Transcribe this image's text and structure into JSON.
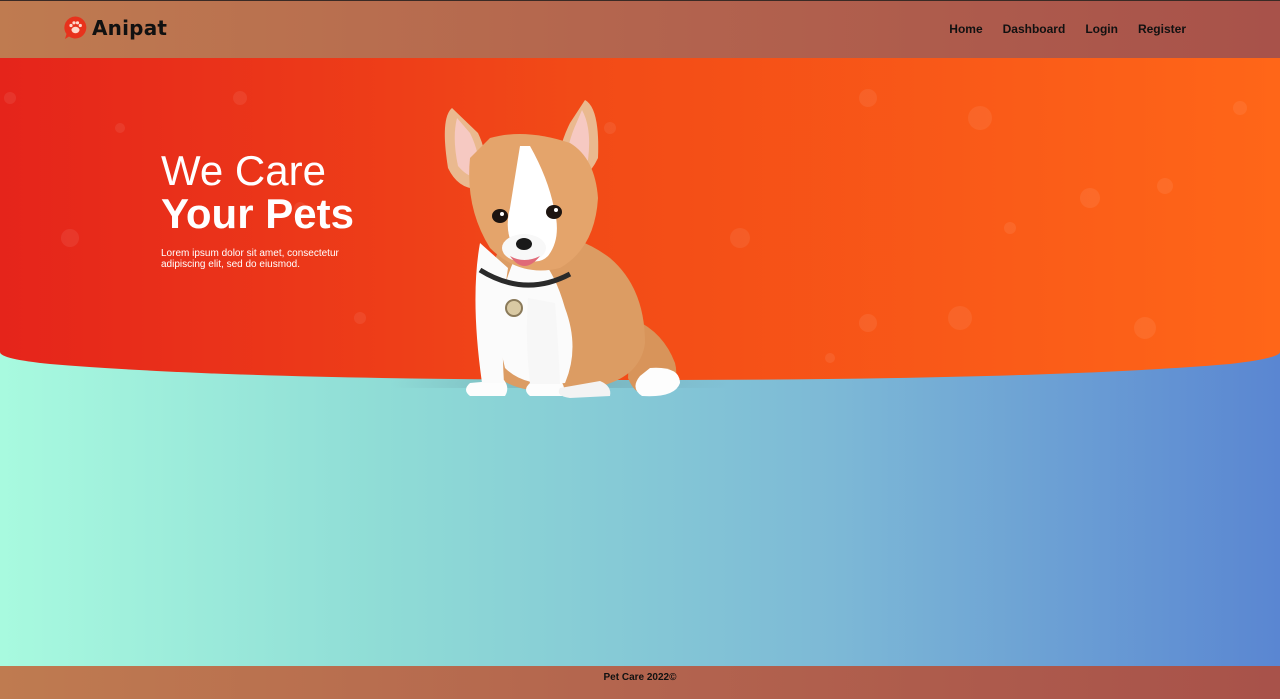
{
  "brand": {
    "name": "Anipat",
    "icon": "paw-chat-logo-icon",
    "accent": "#e8321c"
  },
  "nav": {
    "items": [
      {
        "label": "Home"
      },
      {
        "label": "Dashboard"
      },
      {
        "label": "Login"
      },
      {
        "label": "Register"
      }
    ]
  },
  "hero": {
    "line1": "We Care",
    "line2": "Your Pets",
    "description": "Lorem ipsum dolor sit amet, consectetur adipiscing elit, sed do eiusmod.",
    "image": "corgi-puppy",
    "gradient": [
      "#e5241b",
      "#ff6618"
    ]
  },
  "footer": {
    "text": "Pet Care 2022©"
  }
}
